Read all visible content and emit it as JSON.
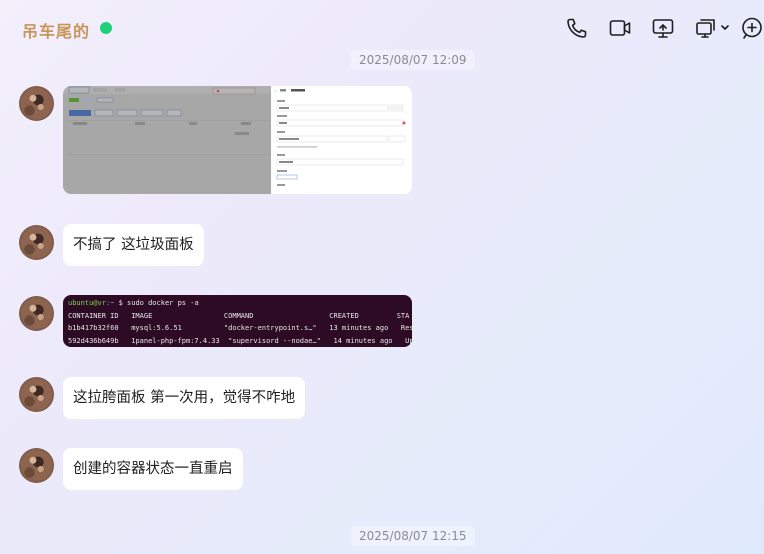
{
  "header": {
    "title": "吊车尾的",
    "status_color": "#21d07a",
    "icons": [
      "phone-icon",
      "video-call-icon",
      "screen-share-icon",
      "multi-window-icon",
      "add-icon"
    ]
  },
  "timestamps": {
    "top": "2025/08/07 12:09",
    "bottom": "2025/08/07 12:15"
  },
  "messages": [
    {
      "type": "image",
      "description_labels": [
        "基本信息"
      ]
    },
    {
      "type": "text",
      "text": "不搞了 这垃圾面板"
    },
    {
      "type": "terminal",
      "prompt_user": "ubuntu@vr",
      "prompt_path": ":~",
      "command": "$ sudo docker ps -a",
      "headers": "CONTAINER ID   IMAGE                 COMMAND                  CREATED         STA",
      "rows": [
        "b1b417b32f60   mysql:5.6.51          \"docker-entrypoint.s…\"   13 minutes ago   Res",
        "592d436b649b   1panel-php-fpm:7.4.33  \"supervisord --nodae…\"   14 minutes ago   Up"
      ]
    },
    {
      "type": "text",
      "text": "这拉胯面板 第一次用，觉得不咋地"
    },
    {
      "type": "text",
      "text": "创建的容器状态一直重启"
    }
  ]
}
